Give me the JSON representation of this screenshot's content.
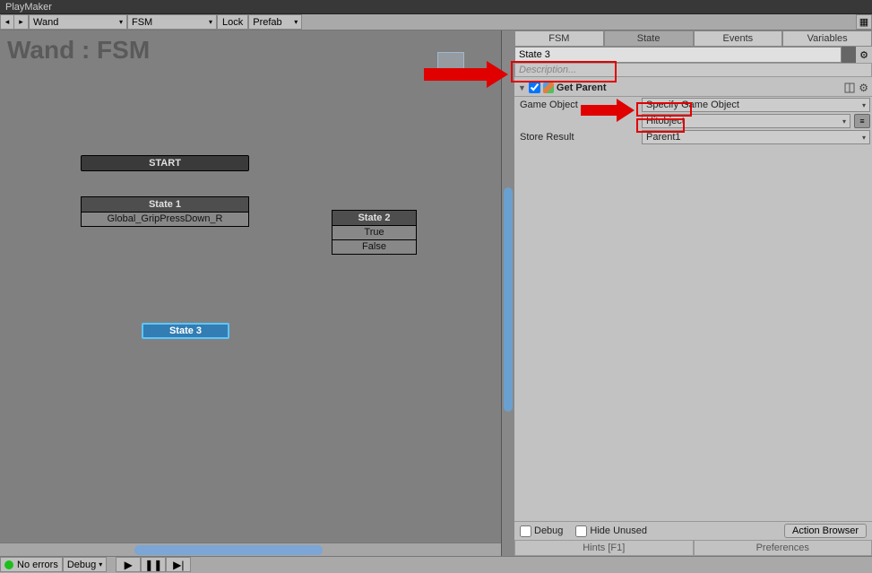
{
  "window": {
    "title": "PlayMaker"
  },
  "toolbar": {
    "fsm_owner": "Wand",
    "fsm_name": "FSM",
    "lock": "Lock",
    "prefab": "Prefab"
  },
  "canvas": {
    "title": "Wand : FSM",
    "nodes": {
      "start": "START",
      "state1": {
        "name": "State 1",
        "events": [
          "Global_GripPressDown_R"
        ]
      },
      "state2": {
        "name": "State 2",
        "events": [
          "True",
          "False"
        ]
      },
      "state3": {
        "name": "State 3"
      }
    }
  },
  "inspector": {
    "tabs": [
      "FSM",
      "State",
      "Events",
      "Variables"
    ],
    "active_tab": 1,
    "state_name": "State 3",
    "description_placeholder": "Description...",
    "action": {
      "name": "Get Parent",
      "enabled": true,
      "props": [
        {
          "label": "Game Object",
          "value": "Specify Game Object"
        },
        {
          "label": "",
          "value": "Hitobject",
          "has_extra_btn": true
        },
        {
          "label": "Store Result",
          "value": "Parent1"
        }
      ]
    },
    "footer": {
      "debug": "Debug",
      "hide_unused": "Hide Unused",
      "action_browser": "Action Browser",
      "hints": "Hints [F1]",
      "preferences": "Preferences"
    }
  },
  "statusbar": {
    "no_errors": "No errors",
    "debug": "Debug"
  }
}
